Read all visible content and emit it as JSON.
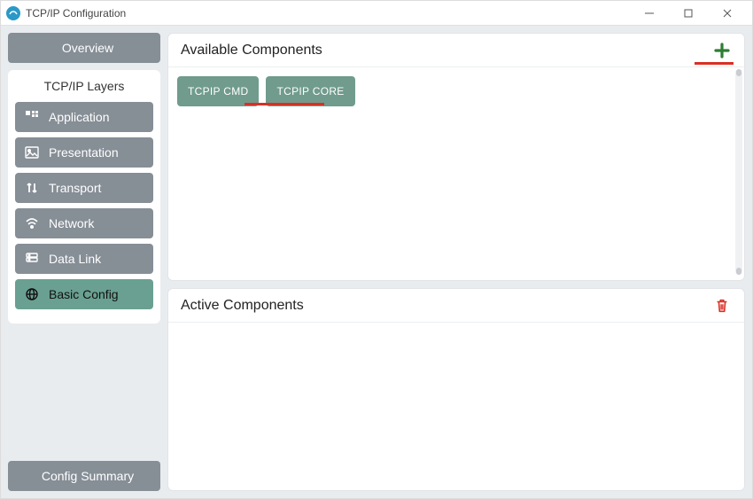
{
  "window": {
    "title": "TCP/IP Configuration"
  },
  "sidebar": {
    "overview_label": "Overview",
    "layers_title": "TCP/IP Layers",
    "summary_label": "Config Summary",
    "layers": [
      {
        "label": "Application",
        "icon": "grid-icon",
        "active": false
      },
      {
        "label": "Presentation",
        "icon": "image-icon",
        "active": false
      },
      {
        "label": "Transport",
        "icon": "sort-icon",
        "active": false
      },
      {
        "label": "Network",
        "icon": "wifi-icon",
        "active": false
      },
      {
        "label": "Data Link",
        "icon": "server-icon",
        "active": false
      },
      {
        "label": "Basic Config",
        "icon": "globe-icon",
        "active": true
      }
    ]
  },
  "panels": {
    "available": {
      "title": "Available Components",
      "components": [
        {
          "label": "TCPIP CMD"
        },
        {
          "label": "TCPIP CORE"
        }
      ]
    },
    "active": {
      "title": "Active Components",
      "components": []
    }
  },
  "highlights": {
    "add_button": true,
    "tcpip_core_chip": true
  },
  "icons": {
    "app": "app-icon",
    "overview": "dashboard-icon",
    "summary": "list-icon",
    "add": "plus-icon",
    "delete": "trash-icon",
    "minimize": "minimize-icon",
    "maximize": "maximize-icon",
    "close": "close-icon"
  }
}
